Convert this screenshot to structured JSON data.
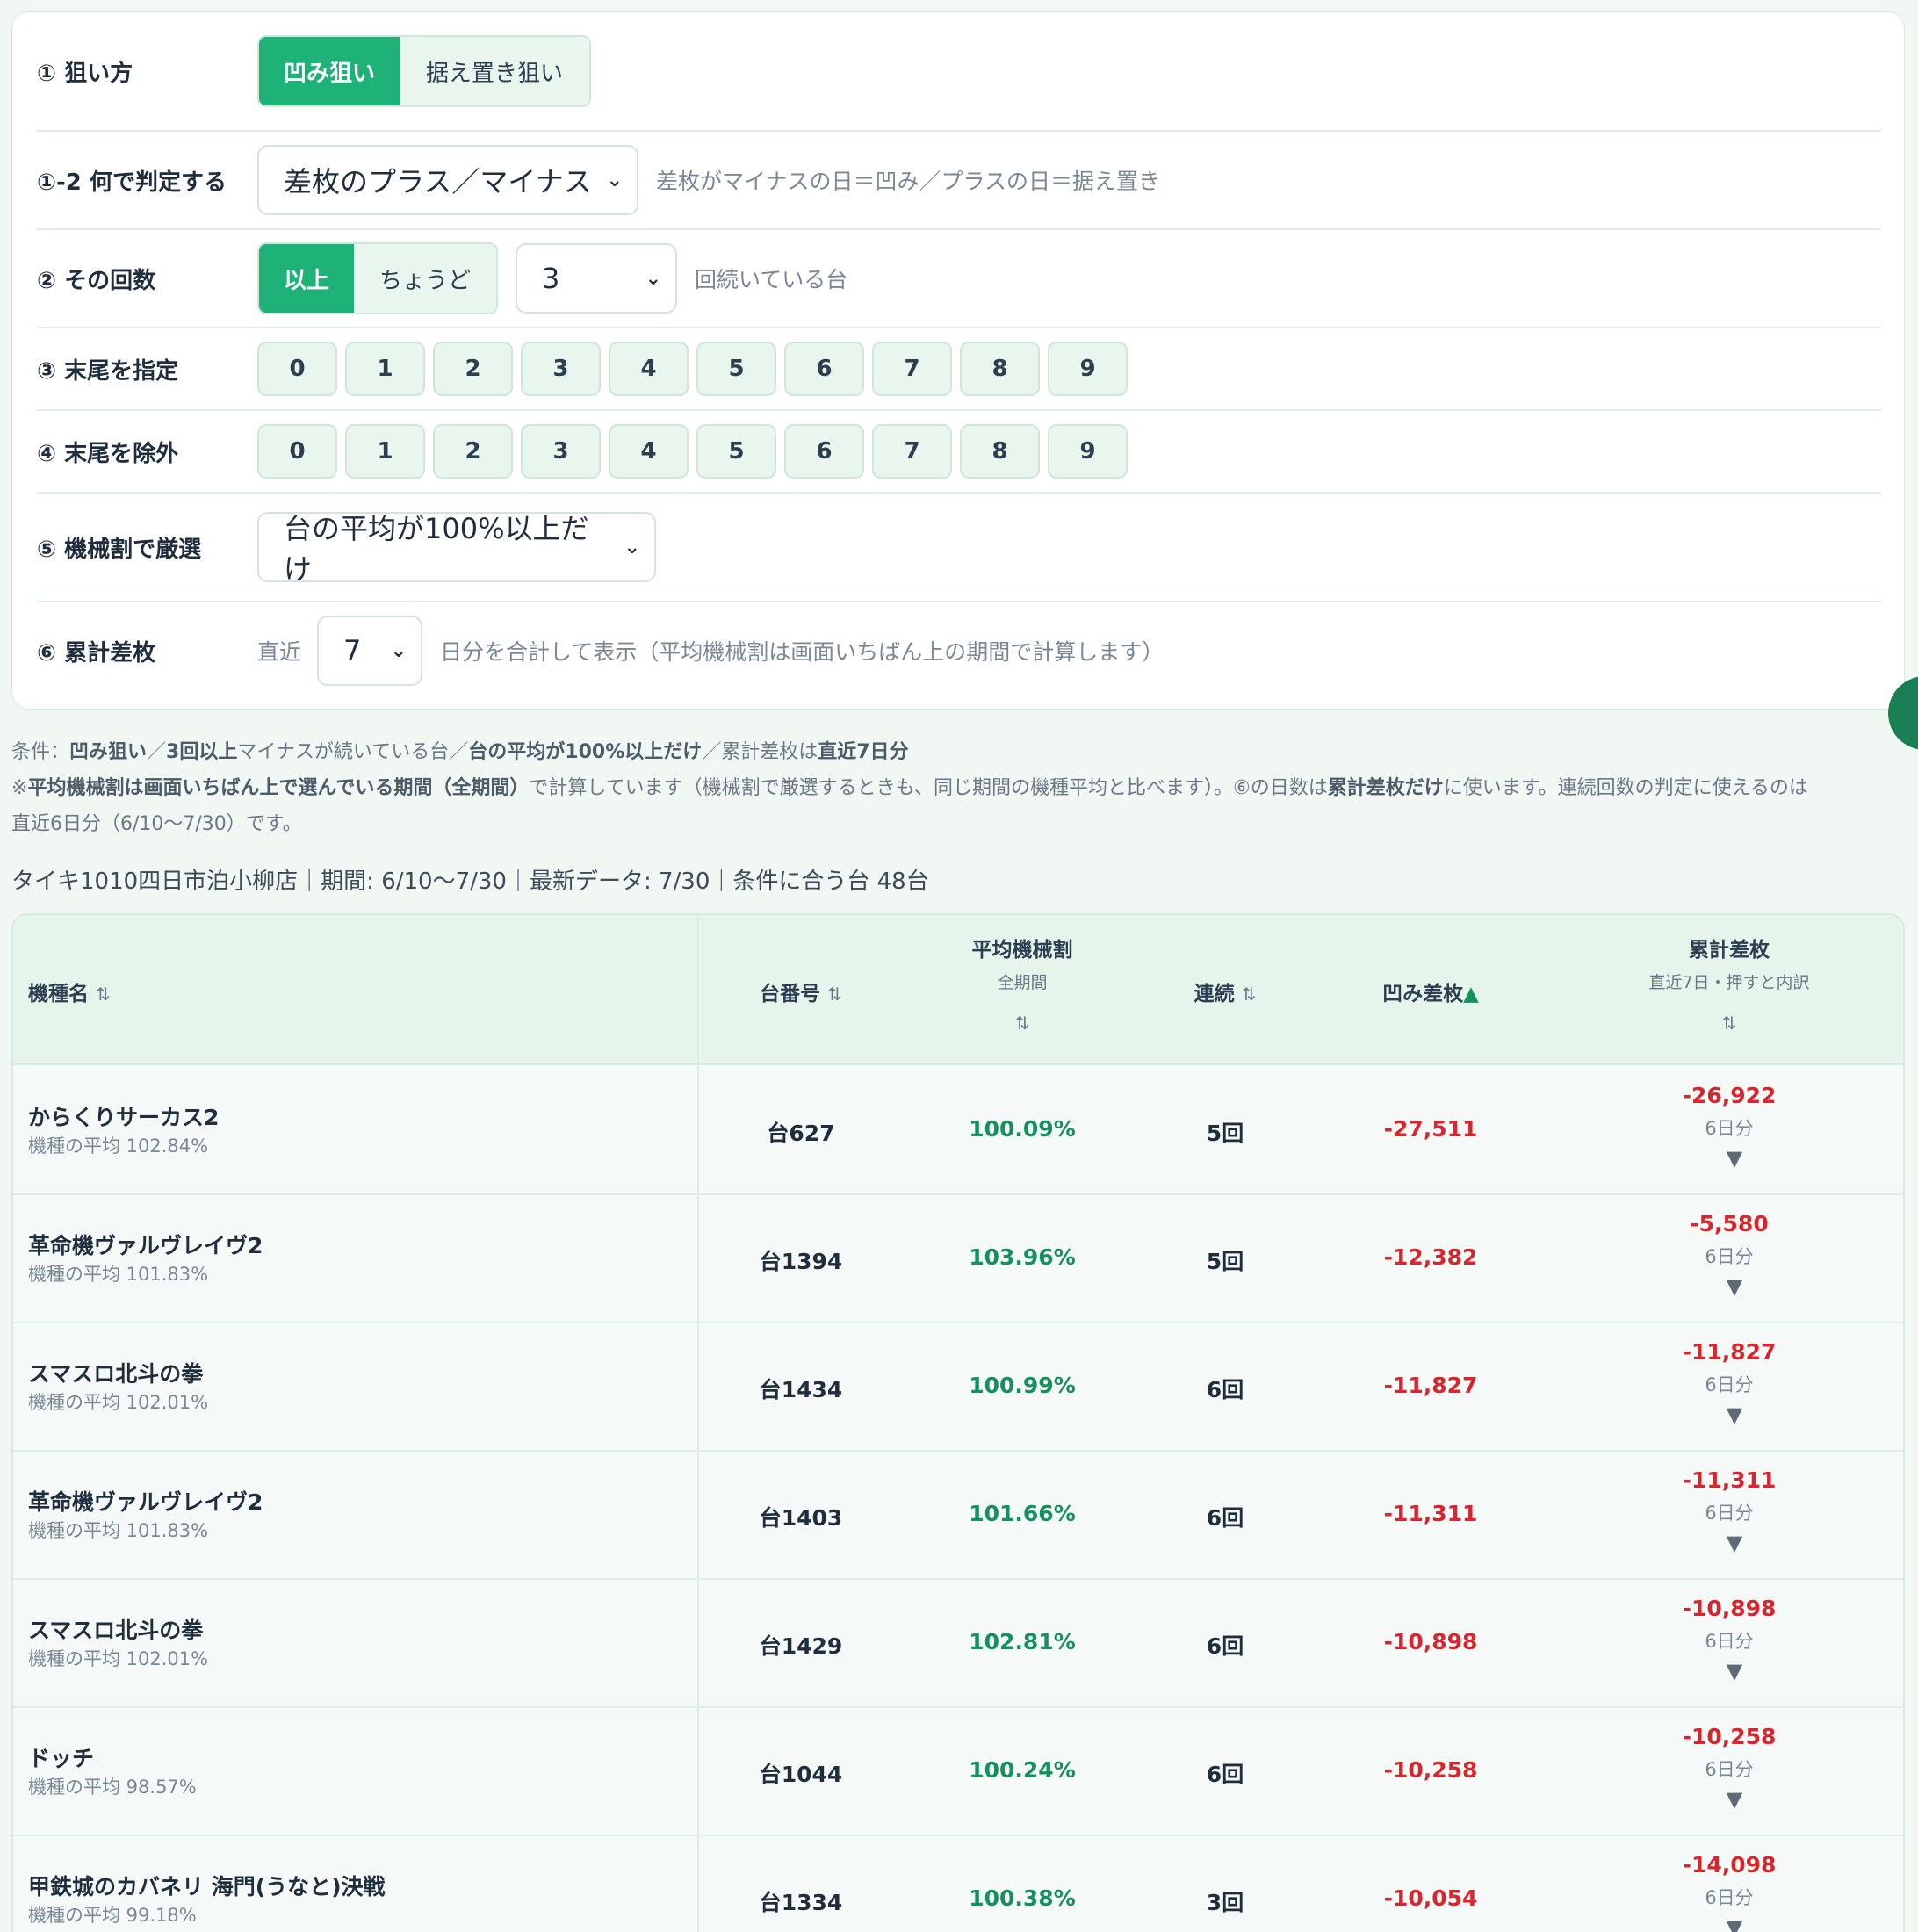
{
  "form": {
    "r1": {
      "label": "① 狙い方",
      "options": [
        "凹み狙い",
        "据え置き狙い"
      ]
    },
    "r12": {
      "label": "①-2 何で判定する",
      "value": "差枚のプラス／マイナス",
      "hint": "差枚がマイナスの日＝凹み／プラスの日＝据え置き"
    },
    "r2": {
      "label": "② その回数",
      "options": [
        "以上",
        "ちょうど"
      ],
      "count": "3",
      "hint": "回続いている台"
    },
    "r3": {
      "label": "③ 末尾を指定",
      "digits": [
        "0",
        "1",
        "2",
        "3",
        "4",
        "5",
        "6",
        "7",
        "8",
        "9"
      ]
    },
    "r4": {
      "label": "④ 末尾を除外",
      "digits": [
        "0",
        "1",
        "2",
        "3",
        "4",
        "5",
        "6",
        "7",
        "8",
        "9"
      ]
    },
    "r5": {
      "label": "⑤ 機械割で厳選",
      "value": "台の平均が100%以上だけ"
    },
    "r6": {
      "label": "⑥ 累計差枚",
      "prefix": "直近",
      "value": "7",
      "hint": "日分を合計して表示（平均機械割は画面いちばん上の期間で計算します）"
    }
  },
  "notes": {
    "l1": {
      "a": "条件：",
      "b": "凹み狙い",
      "c": "／",
      "d": "3回以上",
      "e": "マイナスが続いている台／",
      "f": "台の平均が100%以上だけ",
      "g": "／累計差枚は",
      "h": "直近7日分"
    },
    "l2": {
      "a": "※",
      "b": "平均機械割は画面いちばん上で選んでいる期間（全期間）",
      "c": "で計算しています（機械割で厳選するときも、同じ期間の機種平均と比べます）。⑥の日数は",
      "d": "累計差枚だけ",
      "e": "に使います。連続回数の判定に使えるのは"
    },
    "l3": "直近6日分（6/10〜7/30）です。"
  },
  "summary": "タイキ1010四日市泊小柳店｜期間: 6/10〜7/30｜最新データ: 7/30｜条件に合う台 48台",
  "table": {
    "headers": {
      "name": "機種名",
      "number": "台番号",
      "avg": "平均機械割",
      "avg_sub": "全期間",
      "streak": "連続",
      "dent": "凹み差枚",
      "cum": "累計差枚",
      "cum_sub": "直近7日・押すと内訳",
      "sort": "⇅",
      "asc": "▲"
    },
    "rows": [
      {
        "name": "からくりサーカス2",
        "avg": "機種の平均 102.84%",
        "no": "台627",
        "rate": "100.09%",
        "streak": "5回",
        "dent": "-27,511",
        "cum": "-26,922",
        "days": "6日分"
      },
      {
        "name": "革命機ヴァルヴレイヴ2",
        "avg": "機種の平均 101.83%",
        "no": "台1394",
        "rate": "103.96%",
        "streak": "5回",
        "dent": "-12,382",
        "cum": "-5,580",
        "days": "6日分"
      },
      {
        "name": "スマスロ北斗の拳",
        "avg": "機種の平均 102.01%",
        "no": "台1434",
        "rate": "100.99%",
        "streak": "6回",
        "dent": "-11,827",
        "cum": "-11,827",
        "days": "6日分"
      },
      {
        "name": "革命機ヴァルヴレイヴ2",
        "avg": "機種の平均 101.83%",
        "no": "台1403",
        "rate": "101.66%",
        "streak": "6回",
        "dent": "-11,311",
        "cum": "-11,311",
        "days": "6日分"
      },
      {
        "name": "スマスロ北斗の拳",
        "avg": "機種の平均 102.01%",
        "no": "台1429",
        "rate": "102.81%",
        "streak": "6回",
        "dent": "-10,898",
        "cum": "-10,898",
        "days": "6日分"
      },
      {
        "name": "ドッチ",
        "avg": "機種の平均 98.57%",
        "no": "台1044",
        "rate": "100.24%",
        "streak": "6回",
        "dent": "-10,258",
        "cum": "-10,258",
        "days": "6日分"
      },
      {
        "name": "甲鉄城のカバネリ 海門(うなと)決戦",
        "avg": "機種の平均 99.18%",
        "no": "台1334",
        "rate": "100.38%",
        "streak": "3回",
        "dent": "-10,054",
        "cum": "-14,098",
        "days": "6日分"
      }
    ],
    "expand_icon": "▼"
  }
}
